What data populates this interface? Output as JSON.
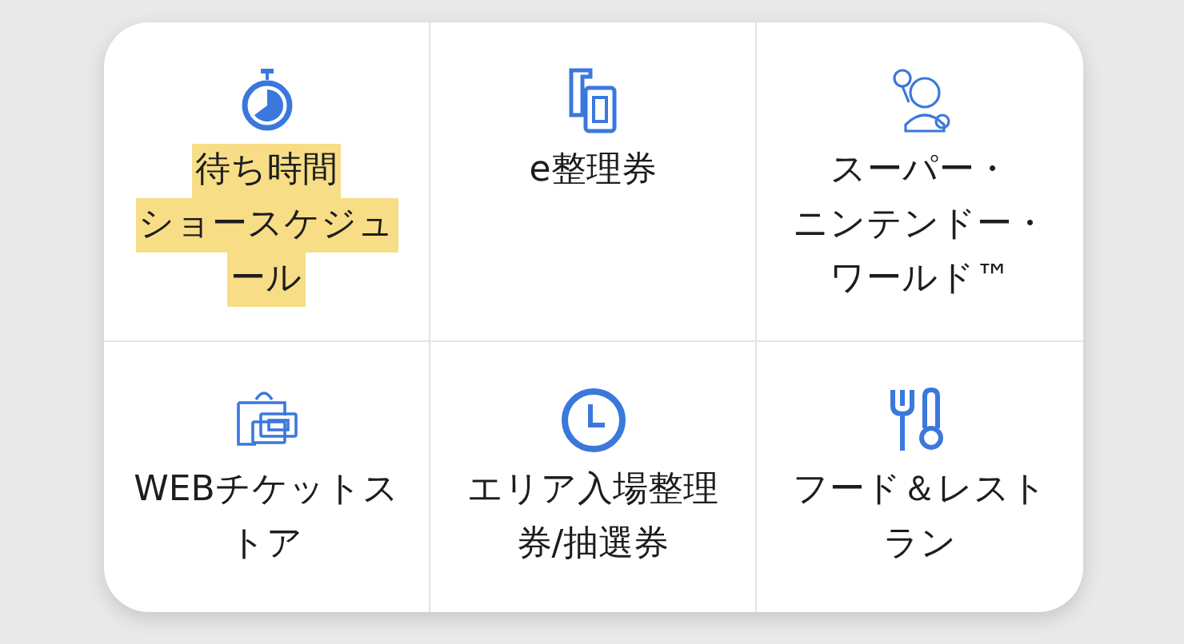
{
  "menu": [
    {
      "lines": [
        "待ち時間",
        "ショースケジュ",
        "ール"
      ],
      "highlighted": true
    },
    {
      "lines": [
        "e整理券"
      ],
      "highlighted": false
    },
    {
      "lines": [
        "スーパー・",
        "ニンテンドー・",
        "ワールド™"
      ],
      "highlighted": false
    },
    {
      "lines": [
        "WEBチケットス",
        "トア"
      ],
      "highlighted": false
    },
    {
      "lines": [
        "エリア入場整理",
        "券/抽選券"
      ],
      "highlighted": false
    },
    {
      "lines": [
        "フード＆レスト",
        "ラン"
      ],
      "highlighted": false
    }
  ]
}
